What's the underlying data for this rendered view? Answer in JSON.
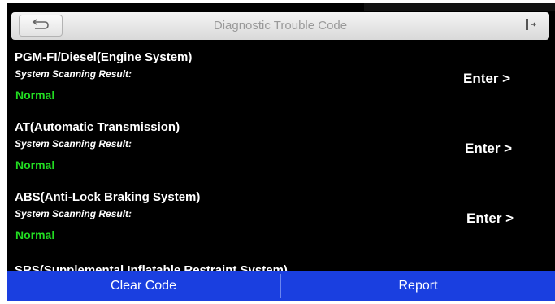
{
  "header": {
    "title": "Diagnostic Trouble Code",
    "back_icon": "back-arrow-icon",
    "exit_icon": "exit-icon"
  },
  "systems": [
    {
      "name": "PGM-FI/Diesel(Engine System)",
      "scan_label": "System Scanning Result:",
      "status": "Normal",
      "action": "Enter >"
    },
    {
      "name": "AT(Automatic Transmission)",
      "scan_label": "System Scanning Result:",
      "status": "Normal",
      "action": "Enter >"
    },
    {
      "name": "ABS(Anti-Lock Braking System)",
      "scan_label": "System Scanning Result:",
      "status": "Normal",
      "action": "Enter >"
    }
  ],
  "partial_item": "SRS(Supplemental Inflatable Restraint System)",
  "footer": {
    "clear_label": "Clear Code",
    "report_label": "Report"
  },
  "colors": {
    "status_ok": "#22dd22",
    "bottom_bar": "#1a3fe0"
  }
}
